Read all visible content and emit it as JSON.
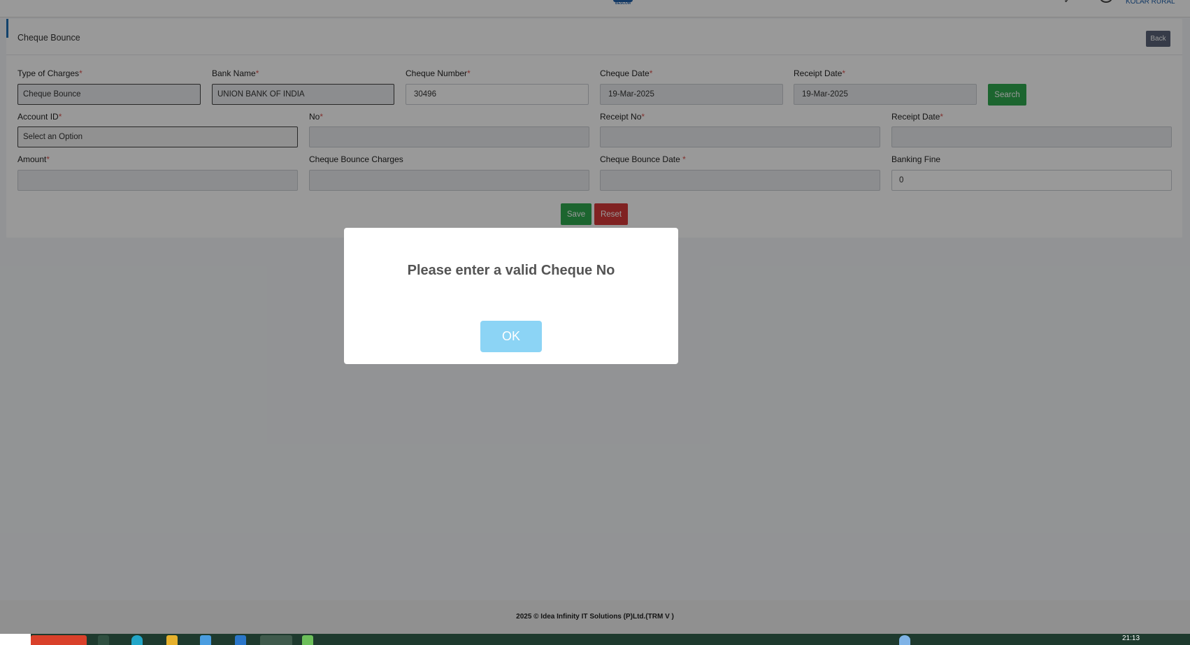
{
  "header": {
    "logo_text": "BESCOM",
    "user_name": "KOLAR RURAL"
  },
  "page": {
    "title": "Cheque Bounce",
    "back_label": "Back"
  },
  "form": {
    "type_of_charges": {
      "label": "Type of Charges",
      "value": "Cheque Bounce"
    },
    "bank_name": {
      "label": "Bank Name",
      "value": "UNION BANK OF INDIA"
    },
    "cheque_number": {
      "label": "Cheque Number",
      "value": "30496"
    },
    "cheque_date": {
      "label": "Cheque Date",
      "value": "19-Mar-2025"
    },
    "receipt_date_top": {
      "label": "Receipt Date",
      "value": "19-Mar-2025"
    },
    "search_label": "Search",
    "account_id": {
      "label": "Account ID",
      "value": "Select an Option"
    },
    "no": {
      "label": "No",
      "value": ""
    },
    "receipt_no": {
      "label": "Receipt No",
      "value": ""
    },
    "receipt_date": {
      "label": "Receipt Date",
      "value": ""
    },
    "amount": {
      "label": "Amount",
      "value": ""
    },
    "cheque_bounce_charges": {
      "label": "Cheque Bounce Charges",
      "value": ""
    },
    "cheque_bounce_date": {
      "label": "Cheque Bounce Date",
      "value": ""
    },
    "banking_fine": {
      "label": "Banking Fine",
      "value": "0"
    },
    "save_label": "Save",
    "reset_label": "Reset",
    "required_mark": "*"
  },
  "modal": {
    "message": "Please enter a valid Cheque No",
    "ok_label": "OK"
  },
  "footer": {
    "text": "2025 © Idea Infinity IT Solutions (P)Ltd.(TRM V )"
  },
  "taskbar": {
    "clock": "21:13"
  }
}
